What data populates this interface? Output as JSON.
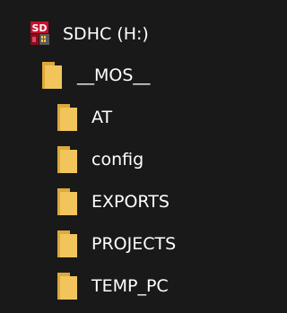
{
  "tree": {
    "drive": {
      "icon": "sd-card-drive-icon",
      "label": "SDHC (H:)"
    },
    "folders": [
      {
        "icon": "folder-icon",
        "label": "__MOS__",
        "level": 1
      },
      {
        "icon": "folder-icon",
        "label": "AT",
        "level": 2
      },
      {
        "icon": "folder-icon",
        "label": "config",
        "level": 2
      },
      {
        "icon": "folder-icon",
        "label": "EXPORTS",
        "level": 2
      },
      {
        "icon": "folder-icon",
        "label": "PROJECTS",
        "level": 2
      },
      {
        "icon": "folder-icon",
        "label": "TEMP_PC",
        "level": 2
      }
    ]
  },
  "colors": {
    "background": "#191919",
    "text": "#ffffff",
    "folder_body": "#f2c55c",
    "folder_back": "#dca93a",
    "drive_red": "#c8102e"
  }
}
